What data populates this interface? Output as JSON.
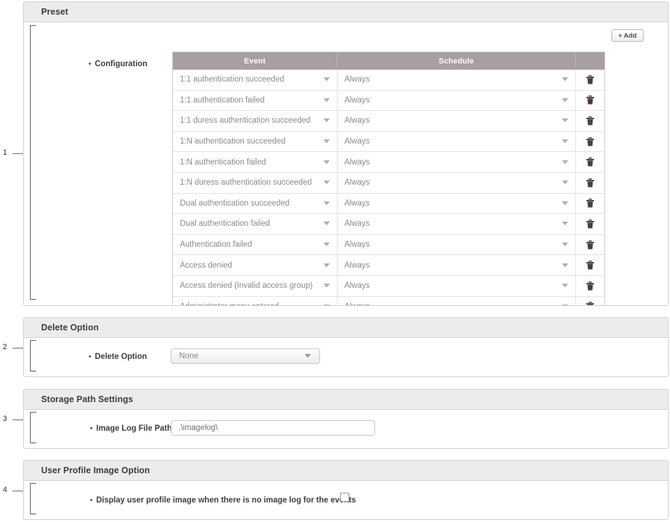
{
  "annotations": [
    {
      "num": "1"
    },
    {
      "num": "2"
    },
    {
      "num": "3"
    },
    {
      "num": "4"
    }
  ],
  "preset": {
    "title": "Preset",
    "configuration_label": "Configuration",
    "add_button_label": "+ Add",
    "table": {
      "columns": [
        "Event",
        "Schedule",
        ""
      ],
      "rows": [
        {
          "event": "1:1 authentication succeeded",
          "schedule": "Always",
          "delete_icon": "trash-icon"
        },
        {
          "event": "1:1 authentication failed",
          "schedule": "Always",
          "delete_icon": "trash-icon"
        },
        {
          "event": "1:1 duress authentication succeeded",
          "schedule": "Always",
          "delete_icon": "trash-icon"
        },
        {
          "event": "1:N authentication succeeded",
          "schedule": "Always",
          "delete_icon": "trash-icon"
        },
        {
          "event": "1:N authentication failed",
          "schedule": "Always",
          "delete_icon": "trash-icon"
        },
        {
          "event": "1:N duress authentication succeeded",
          "schedule": "Always",
          "delete_icon": "trash-icon"
        },
        {
          "event": "Dual authentication succeeded",
          "schedule": "Always",
          "delete_icon": "trash-icon"
        },
        {
          "event": "Dual authentication failed",
          "schedule": "Always",
          "delete_icon": "trash-icon"
        },
        {
          "event": "Authentication failed",
          "schedule": "Always",
          "delete_icon": "trash-icon"
        },
        {
          "event": "Access denied",
          "schedule": "Always",
          "delete_icon": "trash-icon"
        },
        {
          "event": "Access denied (Invalid access group)",
          "schedule": "Always",
          "delete_icon": "trash-icon"
        },
        {
          "event": "Administrator menu entered",
          "schedule": "Always",
          "delete_icon": "trash-icon"
        }
      ]
    }
  },
  "delete_option": {
    "title": "Delete Option",
    "field_label": "Delete Option",
    "value": "None"
  },
  "storage_path": {
    "title": "Storage Path Settings",
    "field_label": "Image Log File Path",
    "value": ".\\imagelog\\"
  },
  "user_profile": {
    "title": "User Profile Image Option",
    "field_label": "Display user profile image when there is no image log for the events",
    "checked": false
  },
  "colors": {
    "table_header": "#a79fa0",
    "panel_header": "#ececea",
    "panel_border": "#d3d0cb",
    "text_muted": "#8a8a8a",
    "text_strong": "#3d3d3d"
  }
}
